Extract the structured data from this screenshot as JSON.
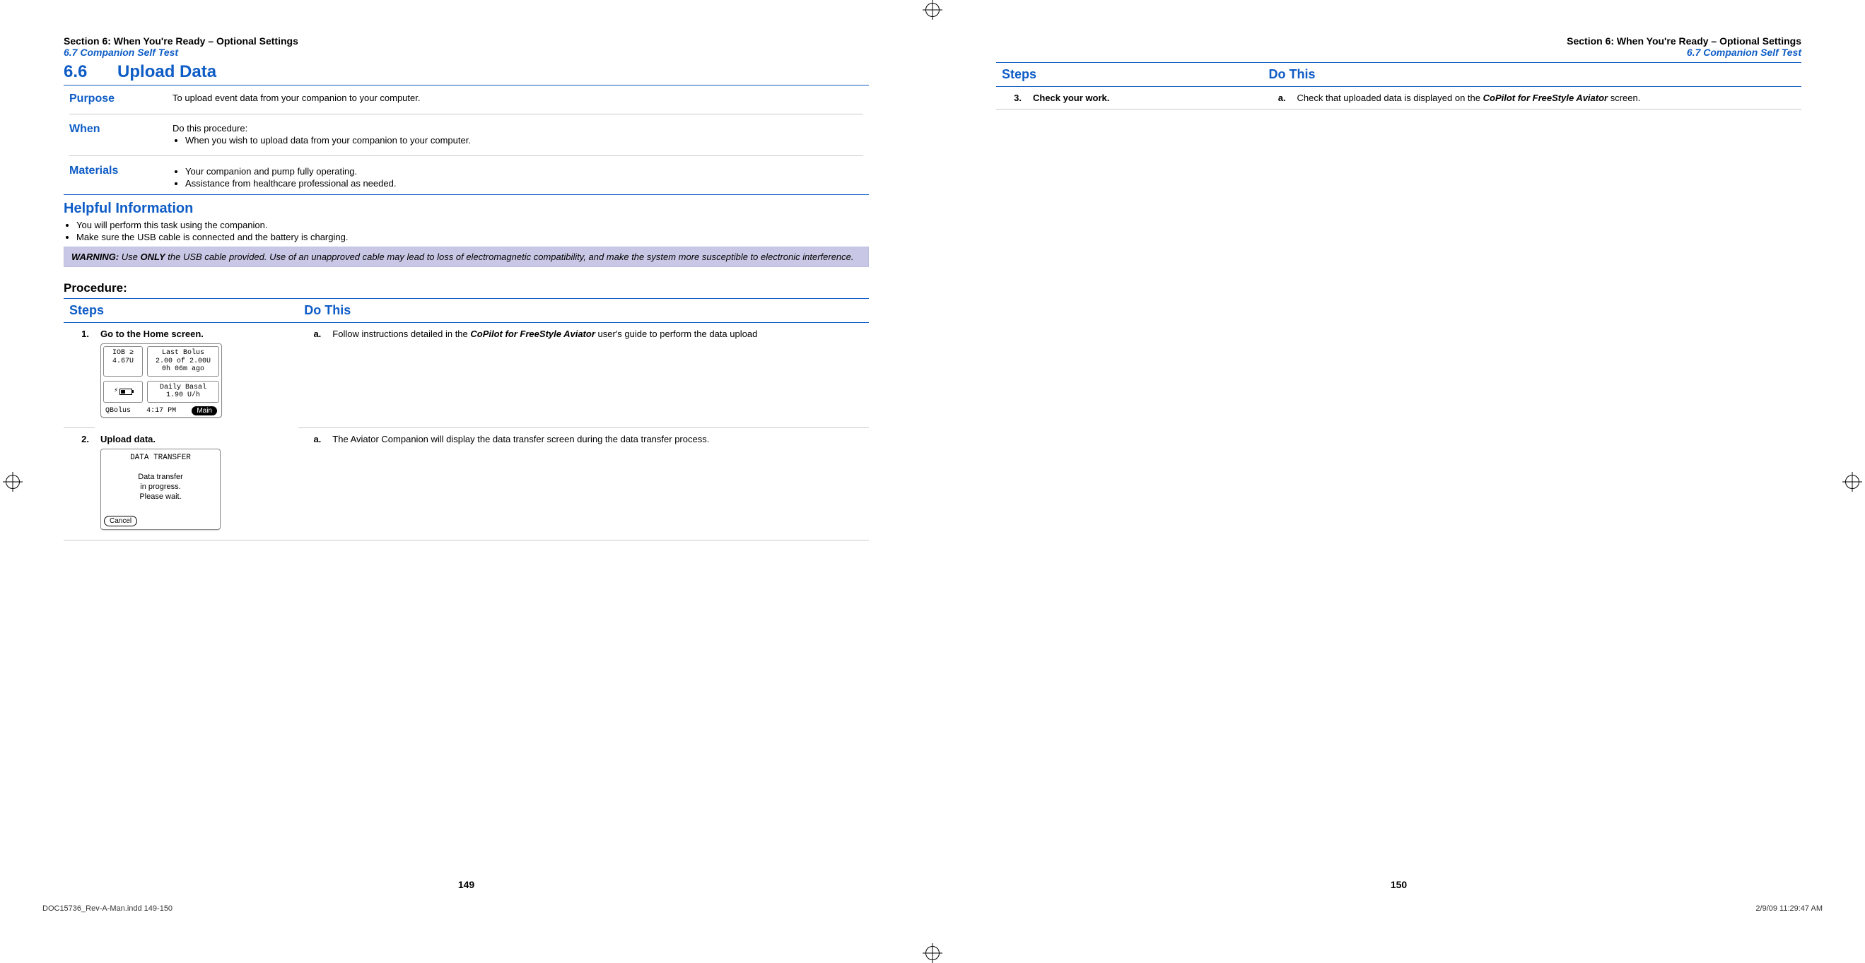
{
  "left": {
    "section_line": "Section 6: When You're Ready – Optional Settings",
    "sub_line": "6.7 Companion Self Test",
    "title_num": "6.6",
    "title_text": "Upload Data",
    "info": {
      "purpose_label": "Purpose",
      "purpose_text": "To upload event data from your companion to your computer.",
      "when_label": "When",
      "when_intro": "Do this procedure:",
      "when_bullet": "When you wish to upload data from your companion to your computer.",
      "materials_label": "Materials",
      "materials_b1": "Your companion and pump fully operating.",
      "materials_b2": "Assistance from healthcare professional as needed."
    },
    "helpful": {
      "heading": "Helpful Information",
      "b1": "You will perform this task using the companion.",
      "b2": "Make sure the USB cable is connected and the battery is charging."
    },
    "warning": {
      "label": "WARNING:",
      "only": "ONLY",
      "pre": "Use ",
      "post": " the USB cable provided. Use of an unapproved cable may lead to loss of electromagnetic compatibility, and make the system more susceptible to electronic interference."
    },
    "procedure_label": "Procedure:",
    "steps_header": {
      "steps": "Steps",
      "do_this": "Do This"
    },
    "step1": {
      "num": "1.",
      "title": "Go to the Home screen.",
      "screen": {
        "iob_label": "IOB ≥",
        "iob_val": "4.67U",
        "lastbolus_label": "Last Bolus",
        "lastbolus_line1": "2.00 of 2.00U",
        "lastbolus_line2": "0h 06m ago",
        "basal_label": "Daily Basal",
        "basal_val": "1.90 U/h",
        "qbolus": "QBolus",
        "time": "4:17 PM",
        "main": "Main"
      },
      "sub_a_letter": "a.",
      "sub_a_pre": "Follow instructions detailed in the ",
      "sub_a_emph": "CoPilot for FreeStyle Aviator",
      "sub_a_post": " user's guide to perform the data upload"
    },
    "step2": {
      "num": "2.",
      "title": "Upload data.",
      "screen": {
        "title": "DATA TRANSFER",
        "line1": "Data transfer",
        "line2": "in progress.",
        "line3": "Please wait.",
        "cancel": "Cancel"
      },
      "sub_a_letter": "a.",
      "sub_a_text": "The Aviator Companion will display the data transfer screen during the data transfer process."
    },
    "pagenum": "149"
  },
  "right": {
    "section_line": "Section 6: When You're Ready – Optional Settings",
    "sub_line": "6.7 Companion Self Test",
    "steps_header": {
      "steps": "Steps",
      "do_this": "Do This"
    },
    "step3": {
      "num": "3.",
      "title": "Check your work.",
      "sub_a_letter": "a.",
      "sub_a_pre": "Check that uploaded data is displayed on the ",
      "sub_a_emph": "CoPilot for FreeStyle Aviator",
      "sub_a_post": " screen."
    },
    "pagenum": "150"
  },
  "footer": {
    "file": "DOC15736_Rev-A-Man.indd   149-150",
    "date": "2/9/09   11:29:47 AM"
  }
}
